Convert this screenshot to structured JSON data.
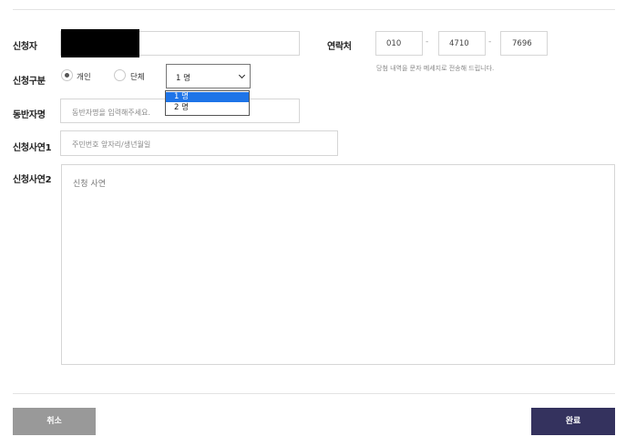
{
  "form": {
    "applicant": {
      "label": "신청자"
    },
    "contact": {
      "label": "연락처",
      "part1": "010",
      "part2": "4710",
      "part3": "7696",
      "separator": "-",
      "note": "당첨 내역을 문자 메세지로 전송해 드립니다."
    },
    "type": {
      "label": "신청구분",
      "options": [
        {
          "label": "개인",
          "checked": true
        },
        {
          "label": "단체",
          "checked": false
        }
      ]
    },
    "count_select": {
      "value": "1 명",
      "options": [
        "1 명",
        "2 명"
      ],
      "highlighted_index": 0
    },
    "companion": {
      "label": "동반자명",
      "placeholder": "동반자명을 입력해주세요."
    },
    "reason1": {
      "label": "신청사연1",
      "placeholder": "주민번호 앞자리/생년월일"
    },
    "reason2": {
      "label": "신청사연2",
      "placeholder": "신청 사연"
    }
  },
  "buttons": {
    "cancel": "취소",
    "submit": "완료"
  },
  "colors": {
    "cancel_bg": "#999999",
    "submit_bg": "#34325e",
    "select_highlight": "#1e74e8",
    "redaction": "#000000"
  }
}
